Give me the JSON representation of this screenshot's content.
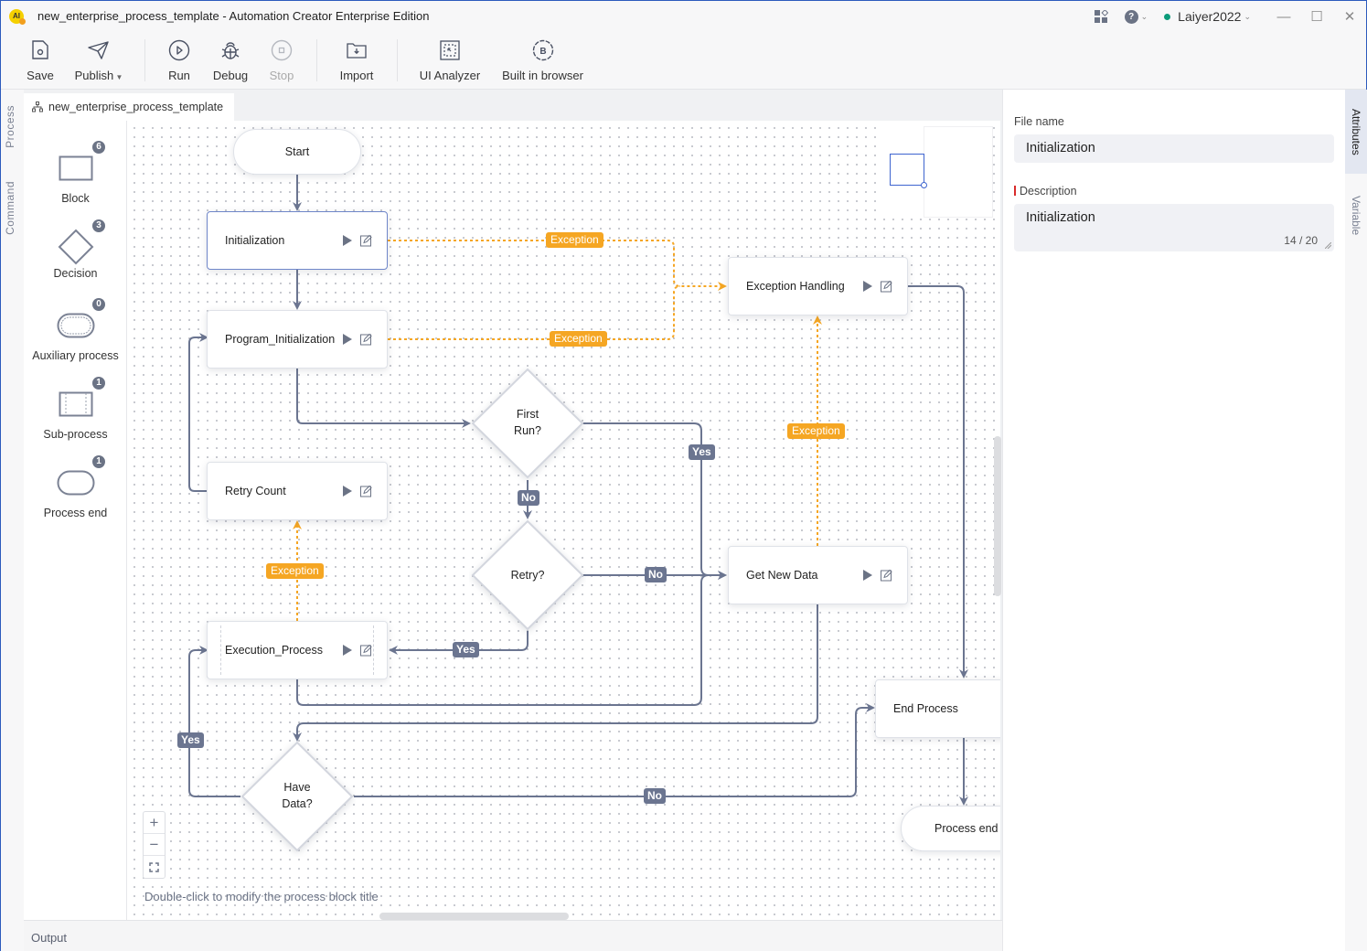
{
  "window": {
    "title": "new_enterprise_process_template - Automation Creator Enterprise Edition",
    "logo_text": "AI",
    "user": "Laiyer2022",
    "user_status": "online"
  },
  "toolbar": {
    "save": "Save",
    "publish": "Publish",
    "run": "Run",
    "debug": "Debug",
    "stop": "Stop",
    "import": "Import",
    "ui_analyzer": "UI Analyzer",
    "built_in_browser": "Built in browser"
  },
  "left_tabs": [
    "Process",
    "Command"
  ],
  "doc_tab": "new_enterprise_process_template",
  "palette": [
    {
      "label": "Block",
      "count": "6",
      "icon": "block-icon"
    },
    {
      "label": "Decision",
      "count": "3",
      "icon": "decision-icon"
    },
    {
      "label": "Auxiliary process",
      "count": "0",
      "icon": "auxiliary-process-icon"
    },
    {
      "label": "Sub-process",
      "count": "1",
      "icon": "sub-process-icon"
    },
    {
      "label": "Process end",
      "count": "1",
      "icon": "process-end-icon"
    }
  ],
  "flow": {
    "start": "Start",
    "nodes": {
      "initialization": "Initialization",
      "program_initialization": "Program_Initialization",
      "retry_count": "Retry Count",
      "execution_process": "Execution_Process",
      "exception_handling": "Exception Handling",
      "get_new_data": "Get New Data",
      "end_process": "End Process"
    },
    "decisions": {
      "first_run": [
        "First",
        "Run?"
      ],
      "retry": [
        "Retry?"
      ],
      "have_data": [
        "Have",
        "Data?"
      ]
    },
    "process_end": "Process end",
    "edge_labels": {
      "exception": "Exception",
      "yes": "Yes",
      "no": "No"
    }
  },
  "canvas": {
    "hint": "Double-click to modify the process block title",
    "zoom_in": "+",
    "zoom_out": "−"
  },
  "output_panel": "Output",
  "attributes": {
    "file_name_label": "File name",
    "file_name_value": "Initialization",
    "description_label": "Description",
    "description_value": "Initialization",
    "description_counter": "14 / 20"
  },
  "right_tabs": [
    "Attributes",
    "Variable"
  ],
  "colors": {
    "edge": "#6b7590",
    "exception": "#f5a623",
    "selected_border": "#6f86c9"
  }
}
